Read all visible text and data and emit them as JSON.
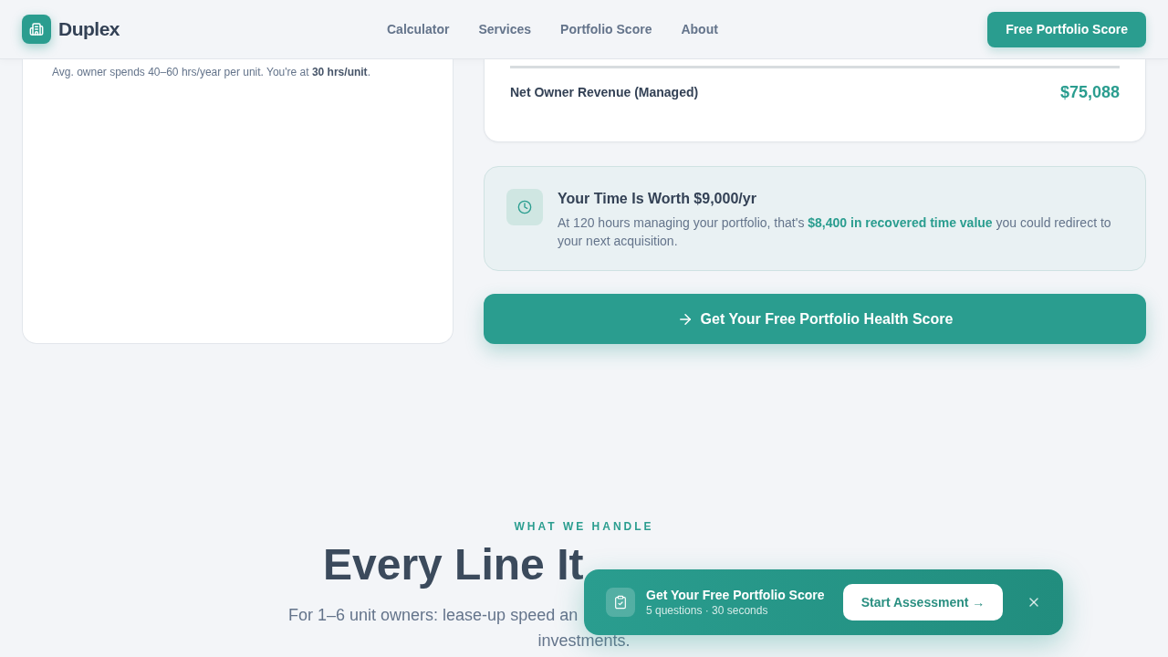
{
  "header": {
    "brand": "Duplex",
    "nav": [
      {
        "label": "Calculator"
      },
      {
        "label": "Services"
      },
      {
        "label": "Portfolio Score"
      },
      {
        "label": "About"
      }
    ],
    "cta": "Free Portfolio Score"
  },
  "time_card": {
    "note": "Avg. owner spends 40–60 hrs/year per unit. You're at **30 hrs/unit**."
  },
  "revenue_card": {
    "label": "Net Owner Revenue (Managed)",
    "value": "$75,088"
  },
  "insight": {
    "title": "Your Time Is Worth $9,000/yr",
    "text": "At 120 hours managing your portfolio, that's **$8,400 in recovered time value** you could redirect to your next acquisition."
  },
  "cta_button": "Get Your Free Portfolio Health Score",
  "section": {
    "eyebrow": "WHAT WE HANDLE",
    "heading": "Every Line It",
    "subtitle_lines": [
      "For 1–6 unit owners: lease-up speed an",
      "investments."
    ]
  },
  "toast": {
    "title": "Get Your Free Portfolio Score",
    "subtitle": "5 questions · 30 seconds",
    "button": "Start Assessment →"
  }
}
